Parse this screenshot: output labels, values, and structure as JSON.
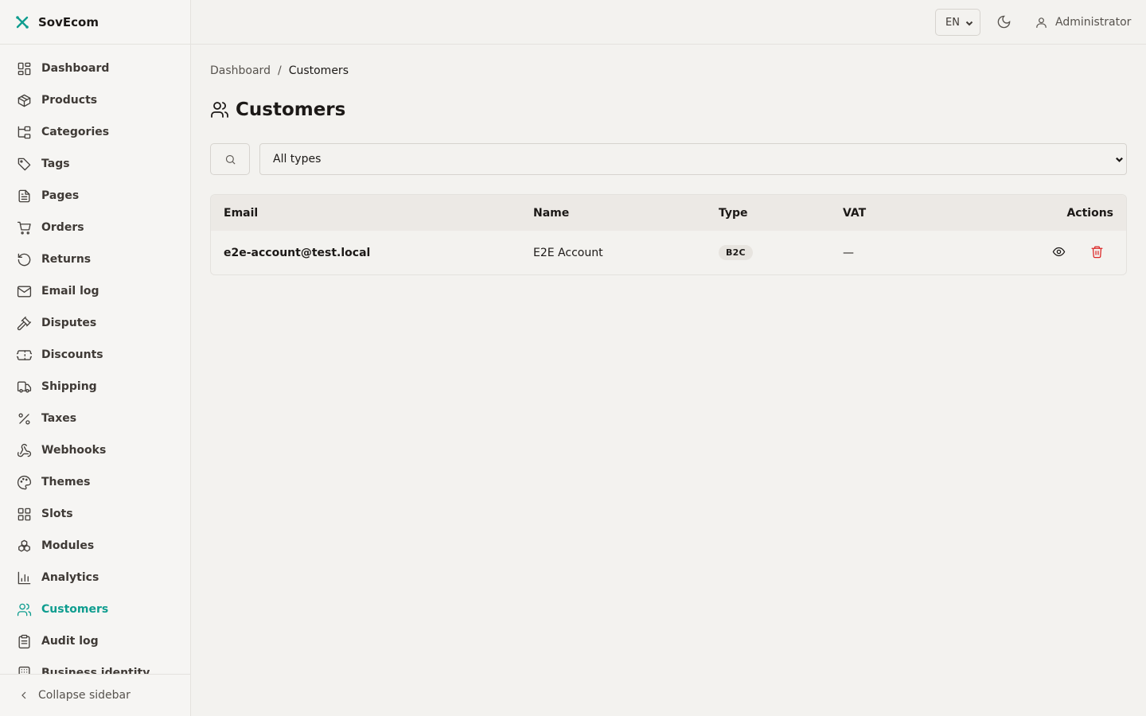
{
  "app": {
    "name": "SovEcom",
    "accent": "#0f9d8f"
  },
  "sidebar": {
    "items": [
      {
        "label": "Dashboard",
        "icon": "dashboard-icon"
      },
      {
        "label": "Products",
        "icon": "package-icon"
      },
      {
        "label": "Categories",
        "icon": "folder-tree-icon"
      },
      {
        "label": "Tags",
        "icon": "tag-icon"
      },
      {
        "label": "Pages",
        "icon": "file-text-icon"
      },
      {
        "label": "Orders",
        "icon": "shopping-cart-icon"
      },
      {
        "label": "Returns",
        "icon": "rotate-ccw-icon"
      },
      {
        "label": "Email log",
        "icon": "mail-icon"
      },
      {
        "label": "Disputes",
        "icon": "gavel-icon"
      },
      {
        "label": "Discounts",
        "icon": "ticket-icon"
      },
      {
        "label": "Shipping",
        "icon": "truck-icon"
      },
      {
        "label": "Taxes",
        "icon": "percent-icon"
      },
      {
        "label": "Webhooks",
        "icon": "webhook-icon"
      },
      {
        "label": "Themes",
        "icon": "palette-icon"
      },
      {
        "label": "Slots",
        "icon": "grid-icon"
      },
      {
        "label": "Modules",
        "icon": "boxes-icon"
      },
      {
        "label": "Analytics",
        "icon": "bar-chart-icon"
      },
      {
        "label": "Customers",
        "icon": "users-icon",
        "active": true
      },
      {
        "label": "Audit log",
        "icon": "clipboard-icon"
      },
      {
        "label": "Business identity",
        "icon": "building-icon"
      }
    ],
    "collapse_label": "Collapse sidebar"
  },
  "topbar": {
    "language": "EN",
    "user": "Administrator"
  },
  "breadcrumb": {
    "root": "Dashboard",
    "separator": "/",
    "current": "Customers"
  },
  "page": {
    "title": "Customers"
  },
  "filters": {
    "type_selected": "All types"
  },
  "table": {
    "headers": {
      "email": "Email",
      "name": "Name",
      "type": "Type",
      "vat": "VAT",
      "actions": "Actions"
    },
    "rows": [
      {
        "email": "e2e-account@test.local",
        "name": "E2E Account",
        "type": "B2C",
        "vat": "—"
      }
    ]
  }
}
